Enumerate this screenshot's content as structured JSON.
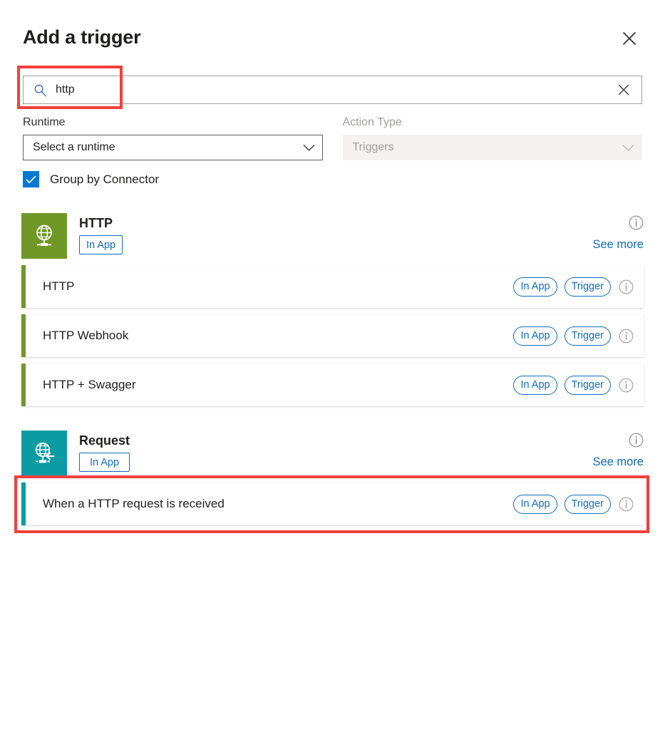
{
  "header": {
    "title": "Add a trigger",
    "close_icon": "close-icon"
  },
  "search": {
    "value": "http",
    "placeholder": "Search",
    "search_icon": "search-icon",
    "clear_icon": "clear-icon"
  },
  "filters": {
    "runtime": {
      "label": "Runtime",
      "value": "Select a runtime",
      "disabled": false
    },
    "action_type": {
      "label": "Action Type",
      "value": "Triggers",
      "disabled": true
    },
    "group_by_connector": {
      "label": "Group by Connector",
      "checked": true
    }
  },
  "labels": {
    "see_more": "See more",
    "in_app": "In App",
    "trigger": "Trigger",
    "info_icon": "info-icon"
  },
  "colors": {
    "accent_blue": "#0078d4",
    "link_blue": "#0f6cbd",
    "http_green": "#6f9826",
    "request_teal": "#0b9ba3",
    "highlight_red": "#f0403c"
  },
  "groups": [
    {
      "name": "HTTP",
      "icon": "globe-icon",
      "icon_color": "#6f9826",
      "accent_color": "#6f9826",
      "badge": "In App",
      "see_more": "See more",
      "operations": [
        {
          "name": "HTTP",
          "badges": [
            "In App",
            "Trigger"
          ],
          "highlighted": false
        },
        {
          "name": "HTTP Webhook",
          "badges": [
            "In App",
            "Trigger"
          ],
          "highlighted": false
        },
        {
          "name": "HTTP + Swagger",
          "badges": [
            "In App",
            "Trigger"
          ],
          "highlighted": false
        }
      ]
    },
    {
      "name": "Request",
      "icon": "globe-arrow-icon",
      "icon_color": "#0b9ba3",
      "accent_color": "#0b9ba3",
      "badge": "In App",
      "see_more": "See more",
      "operations": [
        {
          "name": "When a HTTP request is received",
          "badges": [
            "In App",
            "Trigger"
          ],
          "highlighted": true
        }
      ]
    }
  ]
}
